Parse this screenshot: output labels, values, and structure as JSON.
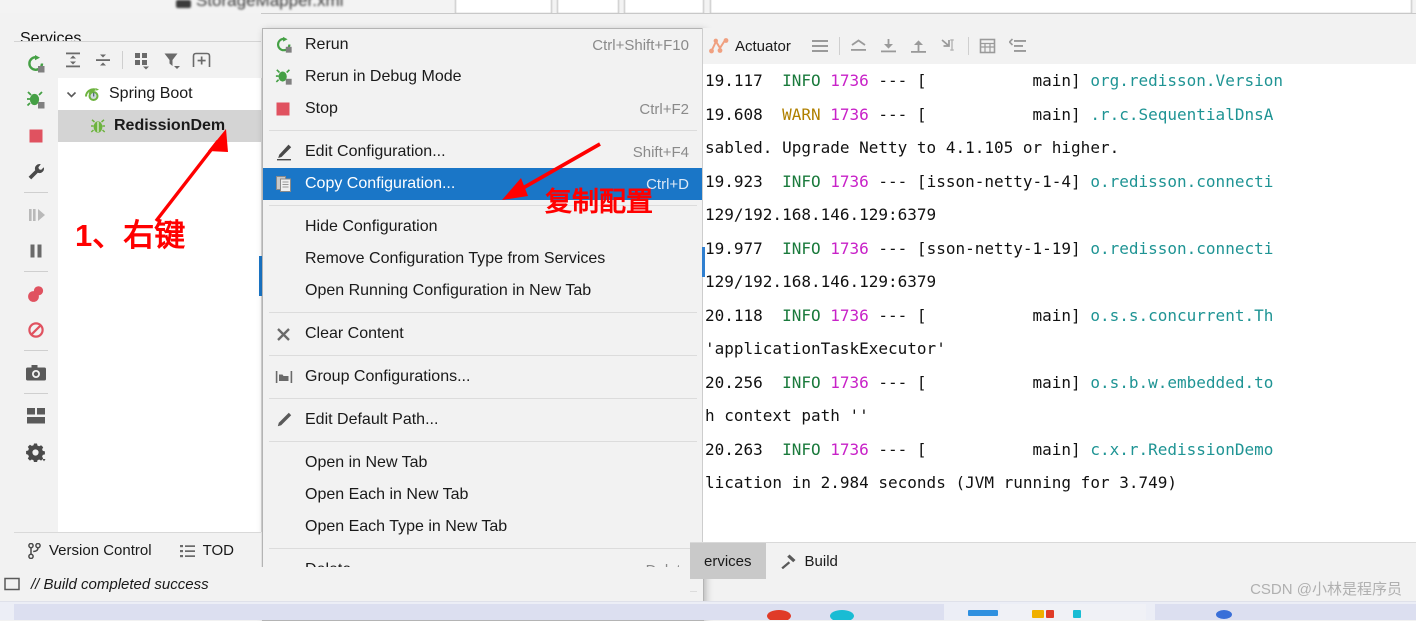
{
  "window": {
    "editor_tab_title": "StorageMapper.xml"
  },
  "services_panel": {
    "title": "Services",
    "toolbar": [
      {
        "name": "expand-all-icon",
        "tooltip": "Expand All"
      },
      {
        "name": "collapse-all-icon",
        "tooltip": "Collapse All"
      },
      {
        "name": "group-by-icon",
        "tooltip": "Group By"
      },
      {
        "name": "filter-icon",
        "tooltip": "Filter"
      },
      {
        "name": "add-tab-icon",
        "tooltip": "Add Tab"
      }
    ],
    "rail": [
      {
        "name": "rerun-icon",
        "tooltip": "Rerun"
      },
      {
        "name": "debug-icon",
        "tooltip": "Rerun in Debug Mode"
      },
      {
        "name": "stop-icon",
        "tooltip": "Stop"
      },
      {
        "name": "settings-wrench-icon",
        "tooltip": "Edit Configuration"
      },
      {
        "name": "resume-program-icon",
        "tooltip": "Resume Program"
      },
      {
        "name": "pause-program-icon",
        "tooltip": "Pause Program"
      },
      {
        "name": "view-breakpoints-icon",
        "tooltip": "View Breakpoints"
      },
      {
        "name": "mute-breakpoints-icon",
        "tooltip": "Mute Breakpoints"
      },
      {
        "name": "camera-icon",
        "tooltip": "Take Snapshot"
      },
      {
        "name": "layout-icon",
        "tooltip": "Layout Settings"
      },
      {
        "name": "gear-icon",
        "tooltip": "Settings"
      }
    ],
    "tree": [
      {
        "label": "Spring Boot",
        "icon": "spring-boot-icon",
        "expanded": true,
        "level": 0,
        "selected": false,
        "bold": false
      },
      {
        "label": "RedissionDem",
        "icon": "spring-bean-icon",
        "expanded": false,
        "level": 1,
        "selected": true,
        "bold": true
      }
    ]
  },
  "context_menu": {
    "items": [
      {
        "type": "item",
        "label": "Rerun",
        "shortcut": "Ctrl+Shift+F10",
        "icon": "rerun-icon",
        "selected": false
      },
      {
        "type": "item",
        "label": "Rerun in Debug Mode",
        "shortcut": "",
        "icon": "debug-icon",
        "selected": false
      },
      {
        "type": "item",
        "label": "Stop",
        "shortcut": "Ctrl+F2",
        "icon": "stop-icon",
        "selected": false
      },
      {
        "type": "separator"
      },
      {
        "type": "item",
        "label": "Edit Configuration...",
        "shortcut": "Shift+F4",
        "icon": "pencil-edit-icon",
        "selected": false
      },
      {
        "type": "item",
        "label": "Copy Configuration...",
        "shortcut": "Ctrl+D",
        "icon": "copy-icon",
        "selected": true
      },
      {
        "type": "separator"
      },
      {
        "type": "item",
        "label": "Hide Configuration",
        "shortcut": "",
        "icon": "",
        "selected": false
      },
      {
        "type": "item",
        "label": "Remove Configuration Type from Services",
        "shortcut": "",
        "icon": "",
        "selected": false
      },
      {
        "type": "item",
        "label": "Open Running Configuration in New Tab",
        "shortcut": "",
        "icon": "",
        "selected": false
      },
      {
        "type": "separator"
      },
      {
        "type": "item",
        "label": "Clear Content",
        "shortcut": "",
        "icon": "close-x-icon",
        "selected": false
      },
      {
        "type": "separator"
      },
      {
        "type": "item",
        "label": "Group Configurations...",
        "shortcut": "",
        "icon": "folder-group-icon",
        "selected": false
      },
      {
        "type": "separator"
      },
      {
        "type": "item",
        "label": "Edit Default Path...",
        "shortcut": "",
        "icon": "pencil-icon",
        "selected": false
      },
      {
        "type": "separator"
      },
      {
        "type": "item",
        "label": "Open in New Tab",
        "shortcut": "",
        "icon": "",
        "selected": false
      },
      {
        "type": "item",
        "label": "Open Each in New Tab",
        "shortcut": "",
        "icon": "",
        "selected": false
      },
      {
        "type": "item",
        "label": "Open Each Type in New Tab",
        "shortcut": "",
        "icon": "",
        "selected": false
      },
      {
        "type": "separator"
      },
      {
        "type": "item",
        "label": "Delete...",
        "shortcut": "Delete",
        "icon": "",
        "selected": false,
        "mnemonic": "D"
      },
      {
        "type": "separator"
      }
    ]
  },
  "console": {
    "tab_label": "Actuator",
    "toolbar": [
      {
        "name": "menu-lines-icon"
      },
      {
        "name": "soft-wrap-icon"
      },
      {
        "name": "scroll-to-end-icon"
      },
      {
        "name": "scroll-to-top-icon"
      },
      {
        "name": "print-icon"
      },
      {
        "name": "table-icon"
      },
      {
        "name": "sort-icon"
      }
    ],
    "log_lines": [
      {
        "time": "19.117",
        "level": "INFO",
        "pid": "1736",
        "thread": "           main]",
        "cls": "org.redisson.Version",
        "wrap": ""
      },
      {
        "time": "19.608",
        "level": "WARN",
        "pid": "1736",
        "thread": "           main]",
        "cls": ".r.c.SequentialDnsA",
        "wrap": "sabled. Upgrade Netty to 4.1.105 or higher."
      },
      {
        "time": "19.923",
        "level": "INFO",
        "pid": "1736",
        "thread": "isson-netty-1-4]",
        "cls": "o.redisson.connecti",
        "wrap": "129/192.168.146.129:6379"
      },
      {
        "time": "19.977",
        "level": "INFO",
        "pid": "1736",
        "thread": "sson-netty-1-19]",
        "cls": "o.redisson.connecti",
        "wrap": "129/192.168.146.129:6379"
      },
      {
        "time": "20.118",
        "level": "INFO",
        "pid": "1736",
        "thread": "           main]",
        "cls": "o.s.s.concurrent.Th",
        "wrap": "'applicationTaskExecutor'"
      },
      {
        "time": "20.256",
        "level": "INFO",
        "pid": "1736",
        "thread": "           main]",
        "cls": "o.s.b.w.embedded.to",
        "wrap": "h context path ''"
      },
      {
        "time": "20.263",
        "level": "INFO",
        "pid": "1736",
        "thread": "           main]",
        "cls": "c.x.r.RedissionDemo",
        "wrap": "lication in 2.984 seconds (JVM running for 3.749)"
      }
    ]
  },
  "bottom_bars": {
    "left_items": [
      {
        "label": "Version Control",
        "icon": "branch-icon",
        "active": false
      },
      {
        "label": "TOD",
        "icon": "todo-list-icon",
        "active": false
      }
    ],
    "right_items": [
      {
        "label": "ervices",
        "icon": "",
        "active": true
      },
      {
        "label": "Build",
        "icon": "hammer-icon",
        "active": false
      }
    ]
  },
  "status_bar": {
    "icon": "terminal-icon",
    "text": "// Build completed success"
  },
  "annotations": [
    {
      "name": "annotation-step-1",
      "text": "1、右键",
      "color": "#ff0000"
    },
    {
      "name": "annotation-copy-config",
      "text": "复制配置",
      "color": "#ff0000"
    }
  ],
  "watermark": {
    "text": "CSDN @小林是程序员"
  },
  "colors": {
    "menu_selection": "#1a76c7",
    "tree_selection": "#d4d4d4",
    "panel_bg": "#f2f2f2",
    "annotation_red": "#ff0000",
    "log_info": "#1a7a3c",
    "log_warn": "#b08000",
    "log_pid": "#c822c8",
    "log_class": "#1f9494"
  }
}
